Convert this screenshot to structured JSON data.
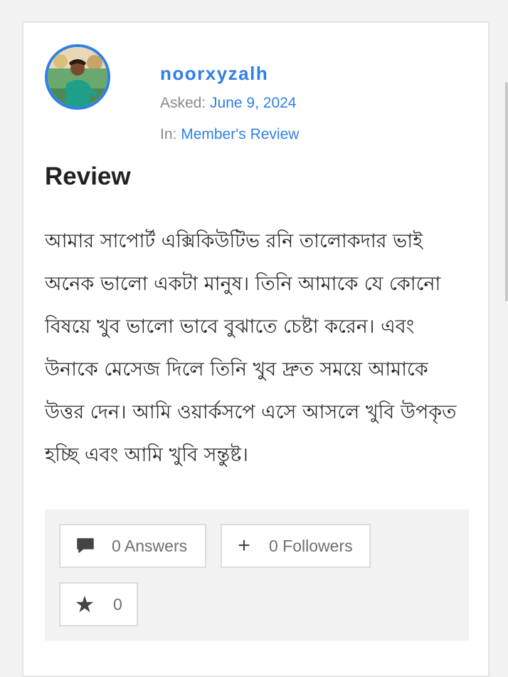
{
  "question": {
    "author": "noorxyzalh",
    "asked_label": "Asked:",
    "asked_date": "June 9, 2024",
    "in_label": "In:",
    "category": "Member's Review",
    "title": "Review",
    "body": "আমার সাপোর্ট এক্সিকিউটিভ রনি তালোকদার ভাই অনেক ভালো একটা মানুষ। তিনি আমাকে যে কোনো বিষয়ে খুব ভালো ভাবে বুঝাতে চেষ্টা করেন। এবং উনাকে মেসেজ দিলে তিনি খুব দ্রুত সময়ে আমাকে উত্তর দেন। আমি ওয়ার্কসপে এসে আসলে খুবি উপকৃত হচ্ছি এবং আমি খুবি সন্তুষ্ট।"
  },
  "actions": {
    "answers": {
      "icon": "comment-icon",
      "label": "0 Answers"
    },
    "followers": {
      "icon": "plus-icon",
      "label": "0 Followers"
    },
    "favorite": {
      "icon": "star-icon",
      "label": "0"
    }
  },
  "colors": {
    "accent": "#2f7fe8",
    "background": "#f2f2f2",
    "card": "#ffffff"
  }
}
